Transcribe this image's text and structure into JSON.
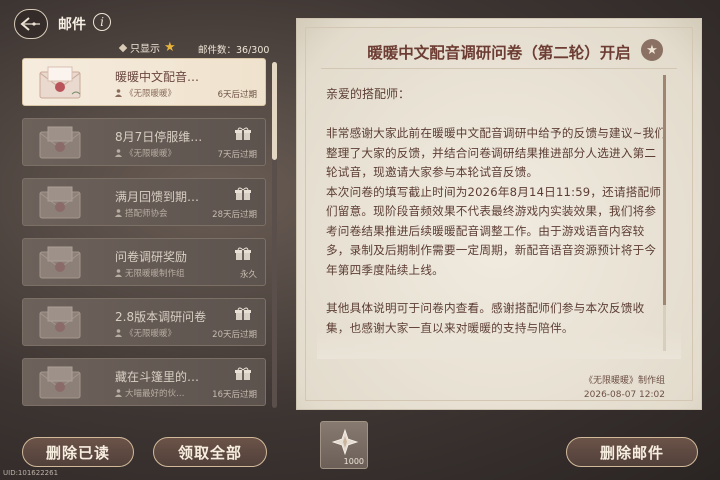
{
  "header": {
    "title": "邮件",
    "info_symbol": "i",
    "filter_label": "只显示",
    "mail_count_label": "邮件数：36/300"
  },
  "mails": [
    {
      "subject": "暖暖中文配音…",
      "sender": "《无限暖暖》",
      "expire": "6天后过期",
      "active": true,
      "has_attachment": false
    },
    {
      "subject": "8月7日停服维…",
      "sender": "《无限暖暖》",
      "expire": "7天后过期",
      "active": false,
      "has_attachment": true
    },
    {
      "subject": "满月回馈到期…",
      "sender": "搭配师协会",
      "expire": "28天后过期",
      "active": false,
      "has_attachment": true
    },
    {
      "subject": "问卷调研奖励",
      "sender": "无限暖暖制作组",
      "expire": "永久",
      "active": false,
      "has_attachment": true
    },
    {
      "subject": "2.8版本调研问卷",
      "sender": "《无限暖暖》",
      "expire": "20天后过期",
      "active": false,
      "has_attachment": true
    },
    {
      "subject": "藏在斗篷里的…",
      "sender": "大喵最好的伙…",
      "expire": "16天后过期",
      "active": false,
      "has_attachment": true
    }
  ],
  "buttons": {
    "delete_read": "删除已读",
    "claim_all": "领取全部",
    "delete_mail": "删除邮件"
  },
  "uid": "UID:101622261",
  "letter": {
    "title": "暖暖中文配音调研问卷（第二轮）开启",
    "greeting": "亲爱的搭配师：",
    "paragraphs": [
      "非常感谢大家此前在暖暖中文配音调研中给予的反馈与建议~我们整理了大家的反馈，并结合问卷调研结果推进部分人选进入第二轮试音，现邀请大家参与本轮试音反馈。",
      "本次问卷的填写截止时间为2026年8月14日11:59，还请搭配师们留意。现阶段音频效果不代表最终游戏内实装效果，我们将参考问卷结果推进后续暖暖配音调整工作。由于游戏语音内容较多，录制及后期制作需要一定周期，新配音语音资源预计将于今年第四季度陆续上线。",
      "其他具体说明可于问卷内查看。感谢搭配师们参与本次反馈收集，也感谢大家一直以来对暖暖的支持与陪伴。"
    ],
    "signature": "《无限暖暖》制作组",
    "date": "2026-08-07 12:02"
  },
  "attachment": {
    "quantity": "1000",
    "icon": "star-crystal-icon"
  },
  "colors": {
    "accent_text": "#6d3d33",
    "star": "#e9b43b",
    "panel_bg": "#ece5d8"
  }
}
